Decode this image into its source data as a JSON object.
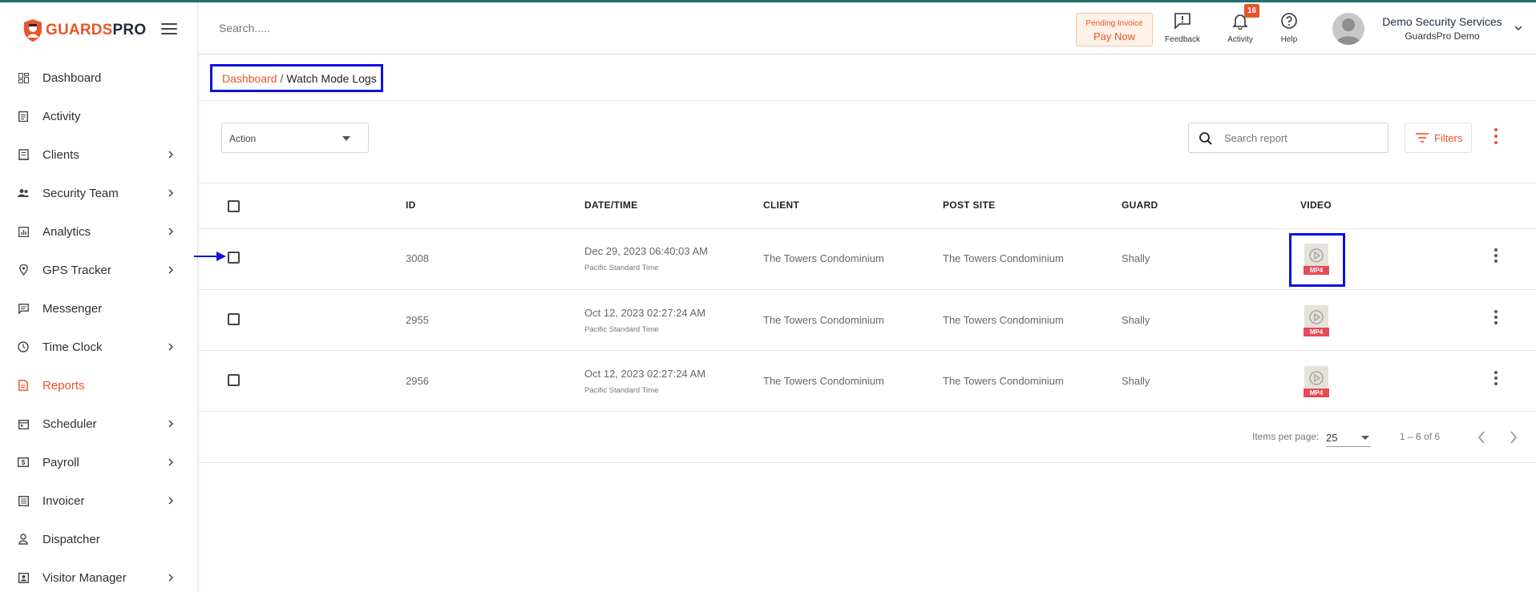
{
  "brand": {
    "name_part1": "GUARDS",
    "name_part2": "PRO",
    "accent": "#e8542a",
    "dark": "#1e2b3c"
  },
  "sidebar": {
    "items": [
      {
        "label": "Dashboard",
        "icon": "dashboard-icon",
        "has_chevron": false
      },
      {
        "label": "Activity",
        "icon": "clipboard-icon",
        "has_chevron": false
      },
      {
        "label": "Clients",
        "icon": "building-icon",
        "has_chevron": true
      },
      {
        "label": "Security Team",
        "icon": "team-icon",
        "has_chevron": true
      },
      {
        "label": "Analytics",
        "icon": "bar-chart-icon",
        "has_chevron": true
      },
      {
        "label": "GPS Tracker",
        "icon": "location-pin-icon",
        "has_chevron": true
      },
      {
        "label": "Messenger",
        "icon": "chat-icon",
        "has_chevron": false
      },
      {
        "label": "Time Clock",
        "icon": "clock-icon",
        "has_chevron": true
      },
      {
        "label": "Reports",
        "icon": "document-icon",
        "has_chevron": false,
        "active": true
      },
      {
        "label": "Scheduler",
        "icon": "calendar-icon",
        "has_chevron": true
      },
      {
        "label": "Payroll",
        "icon": "dollar-icon",
        "has_chevron": true
      },
      {
        "label": "Invoicer",
        "icon": "invoice-icon",
        "has_chevron": true
      },
      {
        "label": "Dispatcher",
        "icon": "dispatcher-icon",
        "has_chevron": false
      },
      {
        "label": "Visitor Manager",
        "icon": "visitor-icon",
        "has_chevron": true
      }
    ]
  },
  "header": {
    "search_placeholder": "Search.....",
    "pending_line1": "Pending Invoice",
    "pending_line2": "Pay Now",
    "feedback_label": "Feedback",
    "activity_label": "Activity",
    "activity_badge": "16",
    "help_label": "Help",
    "user_name": "Demo Security Services",
    "user_company": "GuardsPro Demo"
  },
  "breadcrumb": {
    "root": "Dashboard",
    "separator": "/",
    "current": "Watch Mode Logs"
  },
  "toolbar": {
    "action_label": "Action",
    "search_placeholder": "Search report",
    "filters_label": "Filters"
  },
  "table": {
    "columns": {
      "id": "ID",
      "datetime": "DATE/TIME",
      "client": "CLIENT",
      "post_site": "POST SITE",
      "guard": "GUARD",
      "video": "VIDEO"
    },
    "rows": [
      {
        "id": "3008",
        "datetime": "Dec 29, 2023 06:40:03 AM",
        "timezone": "Pacific Standard Time",
        "client": "The Towers Condominium",
        "post_site": "The Towers Condominium",
        "guard": "Shally",
        "video_format": "MP4"
      },
      {
        "id": "2955",
        "datetime": "Oct 12, 2023 02:27:24 AM",
        "timezone": "Pacific Standard Time",
        "client": "The Towers Condominium",
        "post_site": "The Towers Condominium",
        "guard": "Shally",
        "video_format": "MP4"
      },
      {
        "id": "2956",
        "datetime": "Oct 12, 2023 02:27:24 AM",
        "timezone": "Pacific Standard Time",
        "client": "The Towers Condominium",
        "post_site": "The Towers Condominium",
        "guard": "Shally",
        "video_format": "MP4"
      }
    ]
  },
  "pagination": {
    "items_per_page_label": "Items per page:",
    "items_per_page": "25",
    "range": "1 – 6 of 6"
  },
  "colors": {
    "accent": "#e8542a",
    "highlight": "#1010e0",
    "mp4_tag": "#e84a55"
  }
}
